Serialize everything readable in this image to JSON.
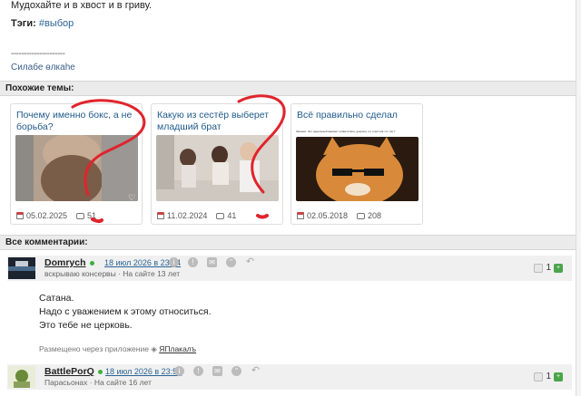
{
  "post": {
    "text": "Мудохайте и в хвост и в гриву.",
    "tags_label": "Тэги:",
    "tag": "#выбор",
    "signature_sep": "---------------------",
    "signature": "Силабе өлкаhе"
  },
  "similar": {
    "heading": "Похожие темы:",
    "cards": [
      {
        "title": "Почему именно бокс, а не борьба?",
        "date": "05.02.2025",
        "comments": "51"
      },
      {
        "title": "Какую из сестёр выберет младший брат",
        "date": "11.02.2024",
        "comments": "41"
      },
      {
        "title": "Всё правильно сделал",
        "image_caption": "Заказал. Это идеальный вариант приветствия, девушку и я счастлив что так ?",
        "date": "02.05.2018",
        "comments": "208"
      }
    ]
  },
  "comments": {
    "heading": "Все комментарии:",
    "items": [
      {
        "author": "Domrych",
        "date": "18 июл 2026 в 23:54",
        "subtitle": "вскрываю консервы · На сайте 13 лет",
        "votes": "1",
        "lines": [
          "Сатана.",
          "Надо с уважением к этому относиться.",
          "Это тебе не церковь."
        ],
        "via_label": "Размещено через приложение",
        "via_app": "ЯПлакалъ"
      },
      {
        "author": "BattlePorQ",
        "date": "18 июл 2026 в 23:55",
        "subtitle": "Парасьонах · На сайте 16 лет",
        "votes": "1"
      }
    ]
  },
  "colors": {
    "link": "#2a6496",
    "scribble": "#e0242c",
    "online": "#3cb043",
    "vote_up": "#4aa54a"
  }
}
